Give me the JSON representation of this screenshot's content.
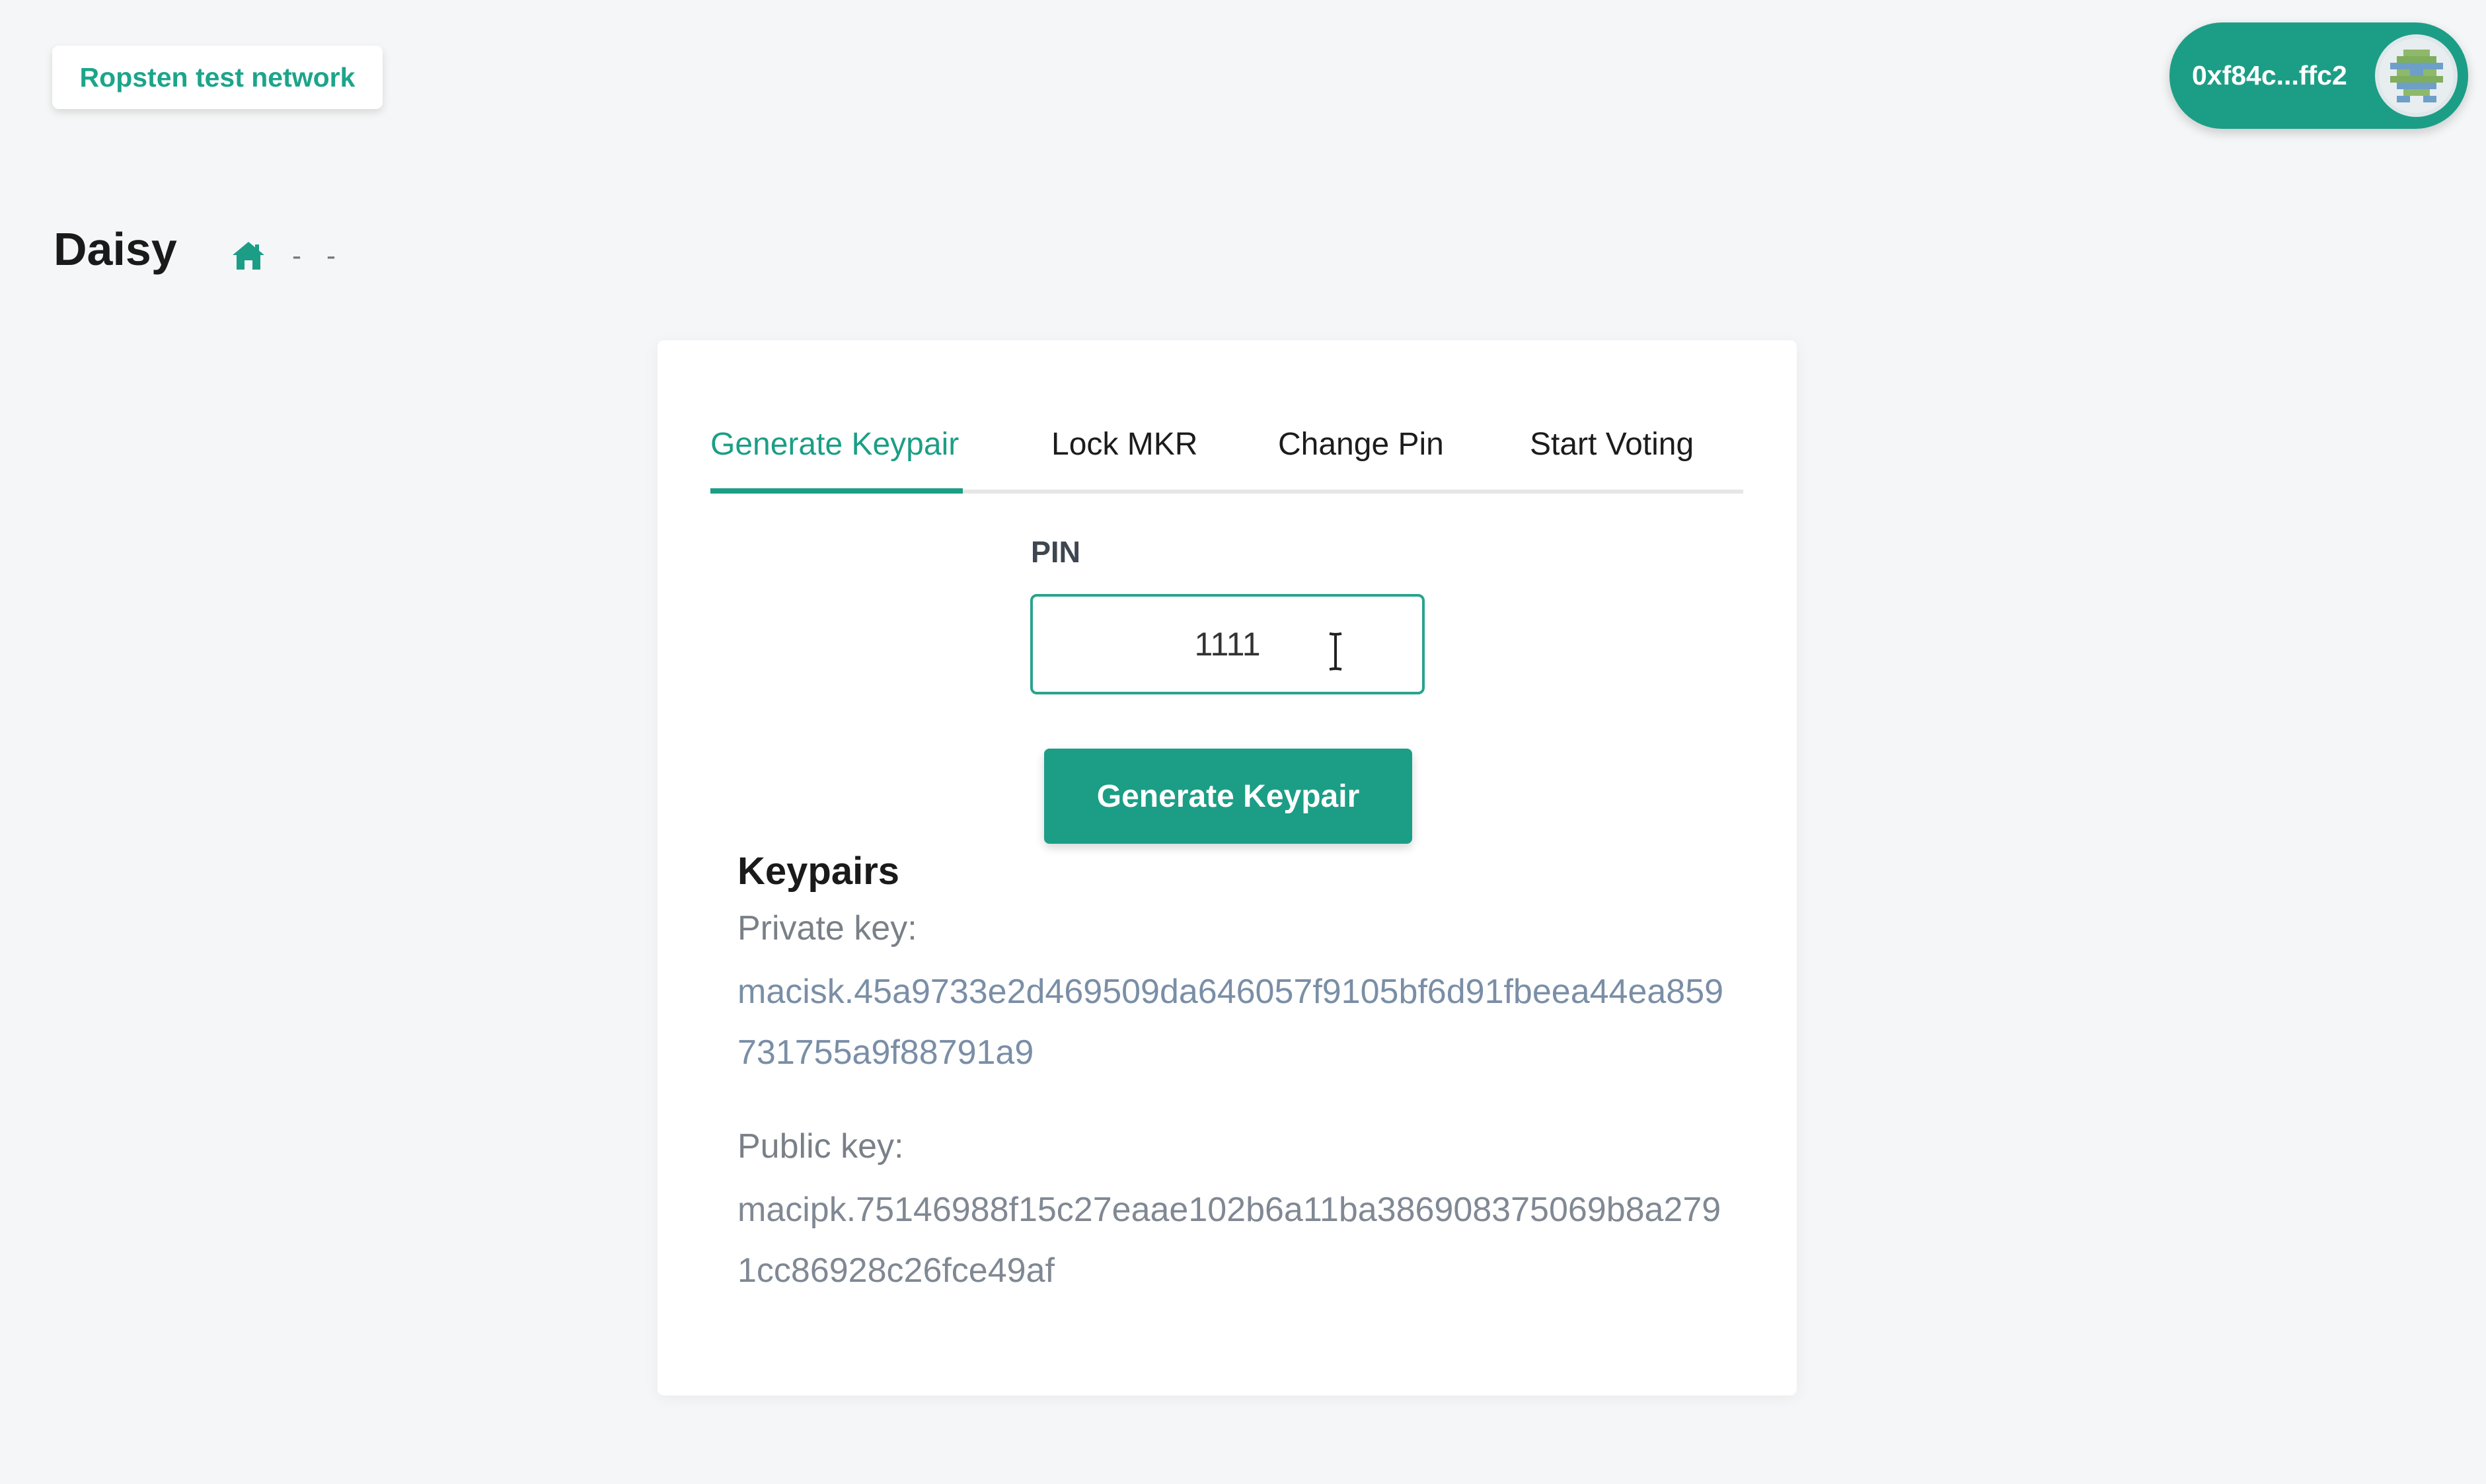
{
  "network": {
    "label": "Ropsten test network"
  },
  "account": {
    "address": "0xf84c...ffc2"
  },
  "header": {
    "title": "Daisy",
    "breadcrumb": [
      "-",
      "-"
    ]
  },
  "tabs": [
    {
      "label": "Generate Keypair",
      "active": true
    },
    {
      "label": "Lock MKR",
      "active": false
    },
    {
      "label": "Change Pin",
      "active": false
    },
    {
      "label": "Start Voting",
      "active": false
    }
  ],
  "pin": {
    "label": "PIN",
    "value": "1111"
  },
  "generate_button": {
    "label": "Generate Keypair"
  },
  "keypairs": {
    "title": "Keypairs",
    "private_label": "Private key:",
    "private_value": "macisk.45a9733e2d469509da646057f9105bf6d91fbeea44ea859731755a9f88791a9",
    "public_label": "Public key:",
    "public_value": "macipk.75146988f15c27eaae102b6a11ba386908375069b8a2791cc86928c26fce49af"
  },
  "colors": {
    "accent": "#1c9e86",
    "background": "#f5f6f7"
  },
  "icons": {
    "home": "home-icon",
    "avatar": "identicon-avatar",
    "cursor": "text-cursor-icon"
  }
}
